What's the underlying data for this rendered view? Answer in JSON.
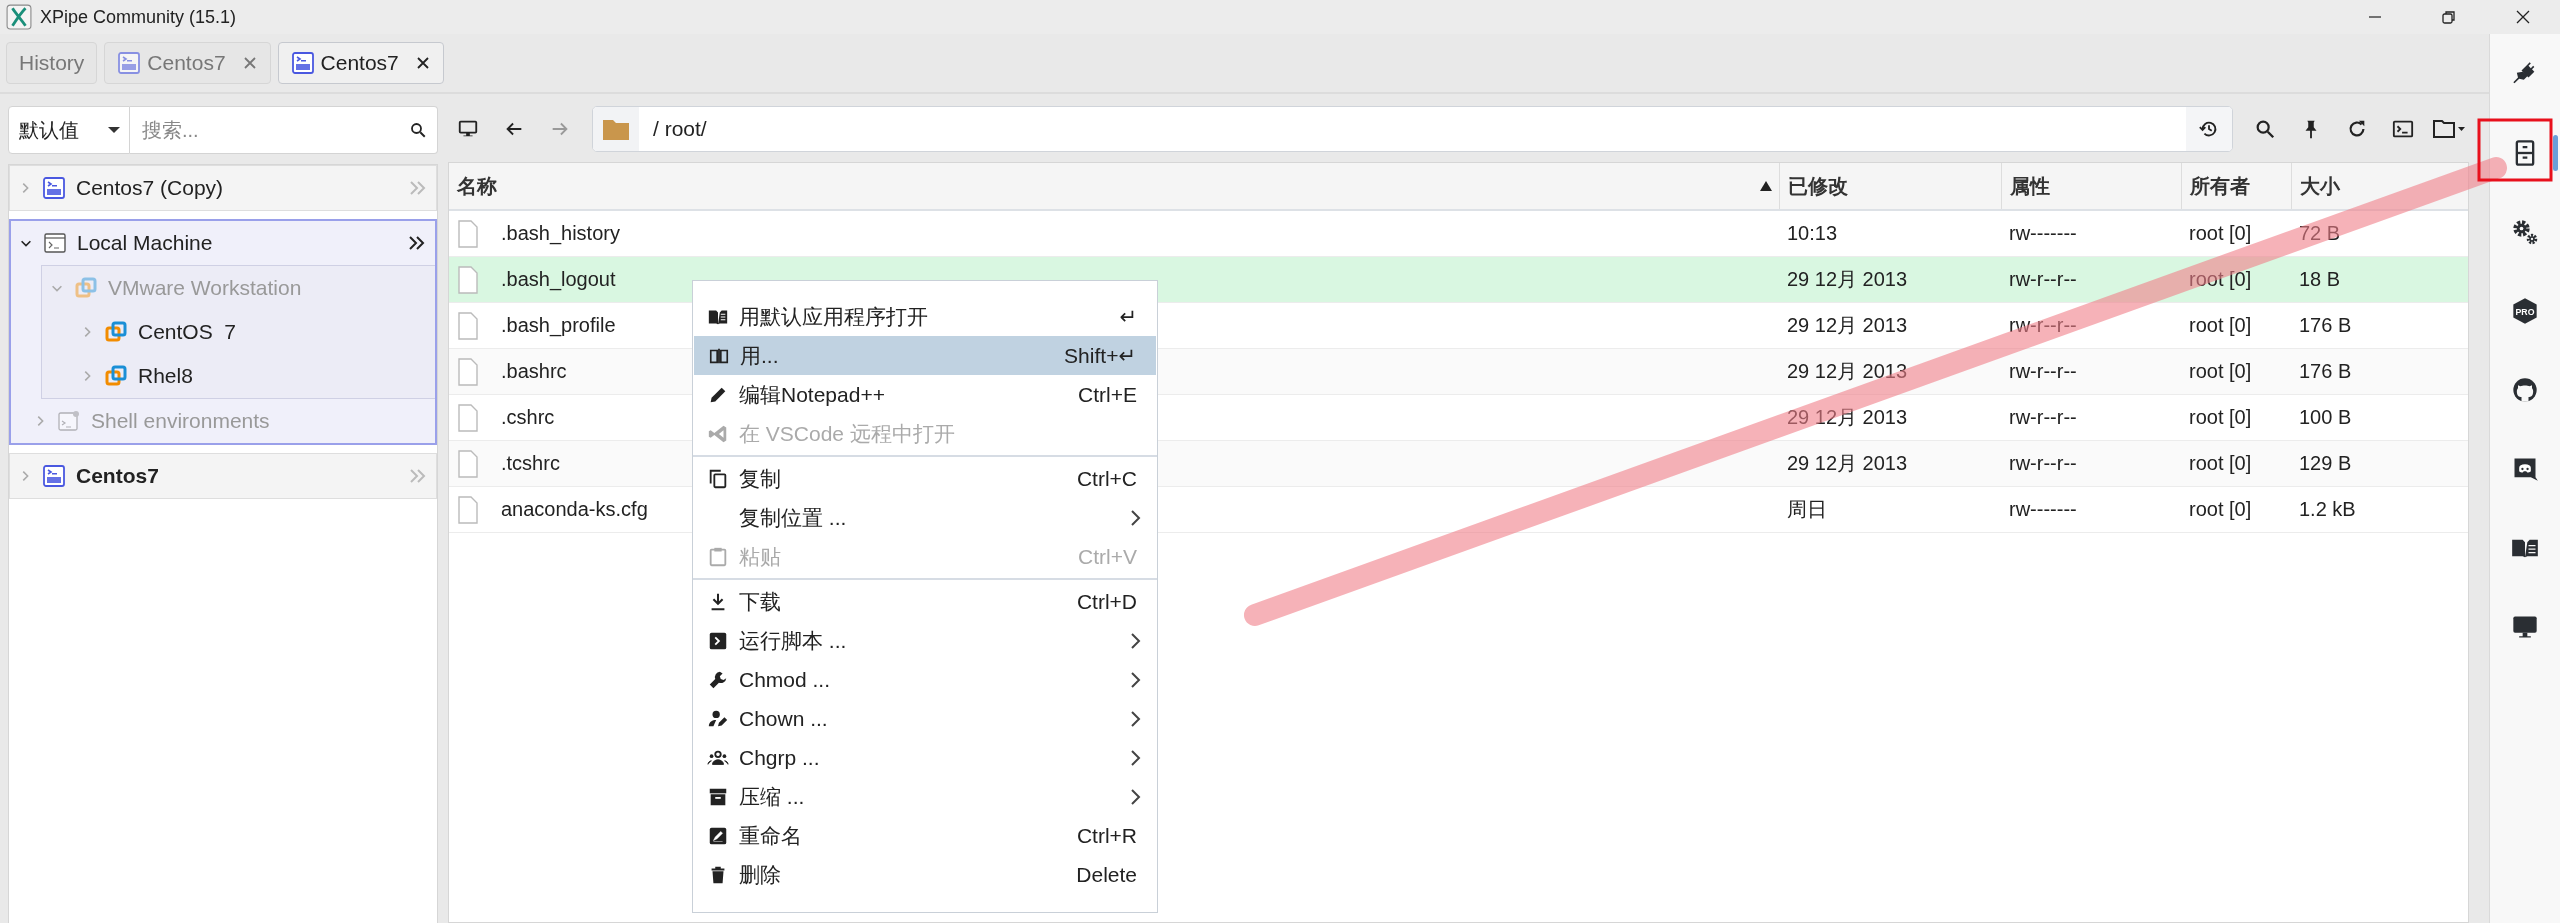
{
  "window": {
    "title": "XPipe Community (15.1)"
  },
  "tabs": [
    {
      "label": "History",
      "kind": "history",
      "selected": false
    },
    {
      "label": "Centos7",
      "kind": "ssh",
      "selected": false
    },
    {
      "label": "Centos7",
      "kind": "ssh",
      "selected": true
    }
  ],
  "connections": {
    "filter": {
      "value": "默认值"
    },
    "search": {
      "placeholder": "搜索..."
    },
    "tree": [
      {
        "label": "Centos7 (Copy)",
        "kind": "ssh",
        "expanded": false,
        "selected": false,
        "active": false,
        "disabled": false
      },
      {
        "label": "Local Machine",
        "kind": "local",
        "expanded": true,
        "selected": true,
        "active": false,
        "disabled": false,
        "children": [
          {
            "label": "VMware Workstation",
            "kind": "vmware",
            "expanded": true,
            "disabled": true,
            "children": [
              {
                "label": "CentOS  7",
                "kind": "vm",
                "expanded": false,
                "disabled": false
              },
              {
                "label": "Rhel8",
                "kind": "vm",
                "expanded": false,
                "disabled": false
              }
            ]
          },
          {
            "label": "Shell environments",
            "kind": "shell",
            "expanded": false,
            "disabled": true
          }
        ]
      },
      {
        "label": "Centos7",
        "kind": "ssh",
        "expanded": false,
        "selected": false,
        "active": true,
        "disabled": false
      }
    ]
  },
  "browser": {
    "path": "/ root/",
    "table": {
      "columns": [
        {
          "label": "名称",
          "sorted": true
        },
        {
          "label": "已修改",
          "sorted": false
        },
        {
          "label": "属性",
          "sorted": false
        },
        {
          "label": "所有者",
          "sorted": false
        },
        {
          "label": "大小",
          "sorted": false
        }
      ],
      "rows": [
        {
          "name": ".bash_history",
          "modified": "10:13",
          "attributes": "rw-------",
          "owner": "root [0]",
          "size": "72 B",
          "selected": false
        },
        {
          "name": ".bash_logout",
          "modified": "29 12月 2013",
          "attributes": "rw-r--r--",
          "owner": "root [0]",
          "size": "18 B",
          "selected": true
        },
        {
          "name": ".bash_profile",
          "modified": "29 12月 2013",
          "attributes": "rw-r--r--",
          "owner": "root [0]",
          "size": "176 B",
          "selected": false
        },
        {
          "name": ".bashrc",
          "modified": "29 12月 2013",
          "attributes": "rw-r--r--",
          "owner": "root [0]",
          "size": "176 B",
          "selected": false
        },
        {
          "name": ".cshrc",
          "modified": "29 12月 2013",
          "attributes": "rw-r--r--",
          "owner": "root [0]",
          "size": "100 B",
          "selected": false
        },
        {
          "name": ".tcshrc",
          "modified": "29 12月 2013",
          "attributes": "rw-r--r--",
          "owner": "root [0]",
          "size": "129 B",
          "selected": false
        },
        {
          "name": "anaconda-ks.cfg",
          "modified": "周日",
          "attributes": "rw-------",
          "owner": "root [0]",
          "size": "1.2 kB",
          "selected": false
        }
      ]
    }
  },
  "context_menu": {
    "groups": [
      [
        {
          "label": "用默认应用程序打开",
          "shortcut": "↵",
          "submenu": false,
          "disabled": false,
          "selected": false
        },
        {
          "label": "用...",
          "shortcut": "Shift+↵",
          "submenu": false,
          "disabled": false,
          "selected": true
        },
        {
          "label": "编辑Notepad++",
          "shortcut": "Ctrl+E",
          "submenu": false,
          "disabled": false,
          "selected": false
        },
        {
          "label": "在 VSCode 远程中打开",
          "submenu": false,
          "disabled": true,
          "selected": false
        }
      ],
      [
        {
          "label": "复制",
          "shortcut": "Ctrl+C",
          "submenu": false,
          "disabled": false,
          "selected": false
        },
        {
          "label": "复制位置 ...",
          "submenu": true,
          "disabled": false,
          "selected": false
        },
        {
          "label": "粘贴",
          "shortcut": "Ctrl+V",
          "submenu": false,
          "disabled": true,
          "selected": false
        }
      ],
      [
        {
          "label": "下载",
          "shortcut": "Ctrl+D",
          "submenu": false,
          "disabled": false,
          "selected": false
        },
        {
          "label": "运行脚本 ...",
          "submenu": true,
          "disabled": false,
          "selected": false
        },
        {
          "label": "Chmod ...",
          "submenu": true,
          "disabled": false,
          "selected": false
        },
        {
          "label": "Chown ...",
          "submenu": true,
          "disabled": false,
          "selected": false
        },
        {
          "label": "Chgrp ...",
          "submenu": true,
          "disabled": false,
          "selected": false
        },
        {
          "label": "压缩 ...",
          "submenu": true,
          "disabled": false,
          "selected": false
        },
        {
          "label": "重命名",
          "shortcut": "Ctrl+R",
          "submenu": false,
          "disabled": false,
          "selected": false
        },
        {
          "label": "删除",
          "shortcut": "Delete",
          "submenu": false,
          "disabled": false,
          "selected": false
        }
      ]
    ]
  },
  "sidebar": {
    "items": [
      {
        "selected": false
      },
      {
        "selected": true
      },
      {
        "selected": false
      },
      {
        "label": "PRO",
        "selected": false
      },
      {
        "selected": false
      },
      {
        "selected": false
      },
      {
        "selected": false
      },
      {
        "selected": false
      }
    ]
  }
}
